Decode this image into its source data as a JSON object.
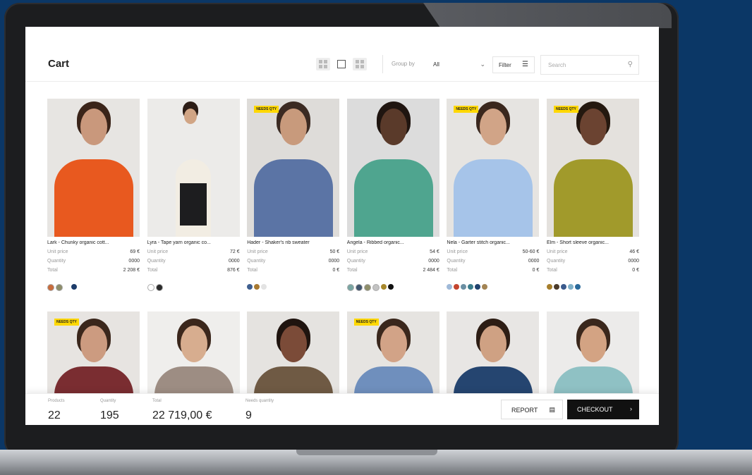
{
  "header": {
    "title": "Cart",
    "group_by_label": "Group by",
    "group_by_value": "All",
    "filter_label": "Filter",
    "search_placeholder": "Search"
  },
  "badge_text": "NEEDS QTY",
  "labels": {
    "unit_price": "Unit price",
    "quantity": "Quantity",
    "total": "Total"
  },
  "products_row1": [
    {
      "name": "Lark - Chunky organic cott...",
      "unit_price": "69 €",
      "quantity": "0000",
      "total": "2 208 €",
      "needs_qty": false,
      "swatches": [
        "#c86c3c",
        "#8e8e6a",
        "#ffffff",
        "#1d3c6a"
      ],
      "colors": {
        "bg": "#e7e5e2",
        "top": "#e8591f",
        "skin": "#c9987c",
        "hair": "#3a2419"
      }
    },
    {
      "name": "Lyra - Tape yarn organic co...",
      "unit_price": "72 €",
      "quantity": "0000",
      "total": "876 €",
      "needs_qty": false,
      "swatches": [
        "#ffffff",
        "#2b2b2b"
      ],
      "colors": {
        "bg": "#ecebe9",
        "top": "#f2ede3",
        "skin": "#d1a585",
        "hair": "#2c1d16"
      }
    },
    {
      "name": "Hader - Shaker's rib sweater",
      "unit_price": "50 €",
      "quantity": "0000",
      "total": "0 €",
      "needs_qty": true,
      "swatches": [
        "#3f5f8f",
        "#a87a32",
        "#e3e3e3"
      ],
      "colors": {
        "bg": "#dedcd9",
        "top": "#5b74a5",
        "skin": "#c89a7c",
        "hair": "#3b2a22"
      }
    },
    {
      "name": "Angela - Ribbed organic...",
      "unit_price": "54 €",
      "quantity": "0000",
      "total": "2 484 €",
      "needs_qty": false,
      "swatches": [
        "#7aa6a3",
        "#42566e",
        "#8e8e6a",
        "#c3c3c3",
        "#a7882c",
        "#111111"
      ],
      "colors": {
        "bg": "#dcdcdc",
        "top": "#4fa58f",
        "skin": "#5a3a2a",
        "hair": "#1f1510"
      }
    },
    {
      "name": "Nela - Garter stitch organic...",
      "unit_price": "50-60 €",
      "quantity": "0000",
      "total": "0 €",
      "needs_qty": true,
      "swatches": [
        "#9fb9d8",
        "#c4452f",
        "#6b8fa3",
        "#3b7d8c",
        "#20426e",
        "#a38454"
      ],
      "colors": {
        "bg": "#e6e4e1",
        "top": "#a6c4e9",
        "skin": "#d1a487",
        "hair": "#3a271d"
      }
    },
    {
      "name": "Elm - Short sleeve organic...",
      "unit_price": "46 €",
      "quantity": "0000",
      "total": "0 €",
      "needs_qty": true,
      "swatches": [
        "#a67e2c",
        "#4b3b2b",
        "#3a5a8c",
        "#7fb0c8",
        "#2a6a9b"
      ],
      "colors": {
        "bg": "#e4e1dd",
        "top": "#a19a2b",
        "skin": "#6b4331",
        "hair": "#24180f"
      }
    }
  ],
  "products_row2": [
    {
      "needs_qty": true,
      "colors": {
        "bg": "#e7e4e1",
        "top": "#7a2d31",
        "skin": "#cc9b80",
        "hair": "#3b271c"
      }
    },
    {
      "needs_qty": false,
      "colors": {
        "bg": "#efeeec",
        "top": "#9d8d83",
        "skin": "#d7ad8f",
        "hair": "#3b271c"
      }
    },
    {
      "needs_qty": false,
      "colors": {
        "bg": "#e5e3e0",
        "top": "#6f5a44",
        "skin": "#7b4b38",
        "hair": "#1f140f"
      }
    },
    {
      "needs_qty": true,
      "colors": {
        "bg": "#e6e4e1",
        "top": "#6f8fbd",
        "skin": "#d2a387",
        "hair": "#3a271c"
      }
    },
    {
      "needs_qty": false,
      "colors": {
        "bg": "#e8e6e4",
        "top": "#254570",
        "skin": "#cfa183",
        "hair": "#2d1d14"
      }
    },
    {
      "needs_qty": false,
      "colors": {
        "bg": "#ecebea",
        "top": "#8fc1c4",
        "skin": "#d3a383",
        "hair": "#3a271c"
      }
    }
  ],
  "footer": {
    "products_label": "Products",
    "products_value": "22",
    "quantity_label": "Quantity",
    "quantity_value": "195",
    "total_label": "Total",
    "total_value": "22 719,00 €",
    "needs_label": "Needs quantity",
    "needs_value": "9",
    "report_label": "REPORT",
    "checkout_label": "CHECKOUT"
  }
}
